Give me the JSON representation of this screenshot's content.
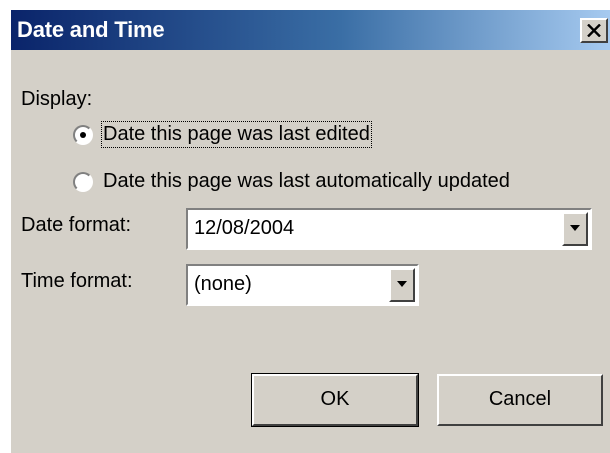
{
  "dialog": {
    "title": "Date and Time",
    "close_glyph": "×"
  },
  "display": {
    "label": "Display:",
    "options": [
      {
        "label": "Date this page was last edited",
        "selected": true
      },
      {
        "label": "Date this page was last automatically updated",
        "selected": false
      }
    ]
  },
  "date_format": {
    "label": "Date format:",
    "value": "12/08/2004"
  },
  "time_format": {
    "label": "Time format:",
    "value": "(none)"
  },
  "buttons": {
    "ok": "OK",
    "cancel": "Cancel"
  },
  "colors": {
    "titlebar_start": "#0a246a",
    "titlebar_end": "#a6caf0",
    "face": "#d4d0c8"
  },
  "icons": {
    "close": "close-icon",
    "dropdown": "chevron-down-icon"
  }
}
